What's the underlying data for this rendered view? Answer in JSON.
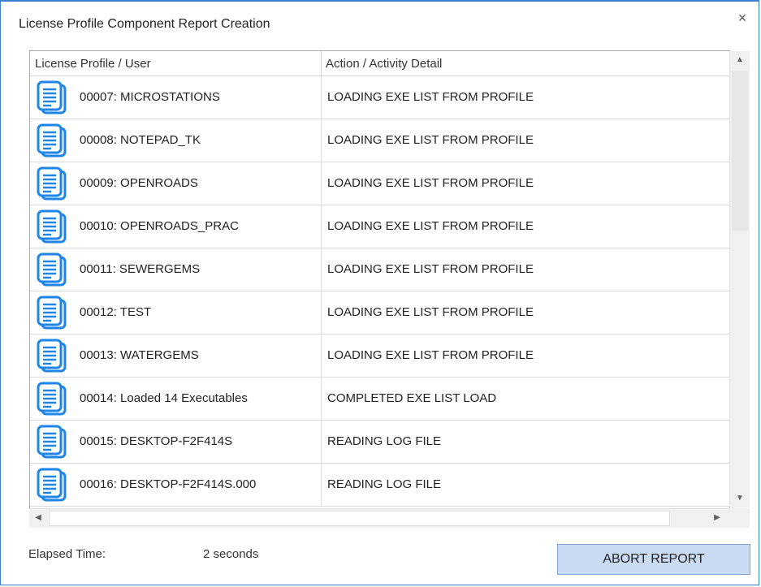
{
  "window": {
    "title": "License Profile Component Report Creation",
    "close_symbol": "×"
  },
  "grid": {
    "columns": [
      "License Profile / User",
      "Action / Activity Detail"
    ],
    "rows": [
      {
        "icon": "document-icon",
        "profile": "00007: MICROSTATIONS",
        "action": "LOADING EXE LIST FROM PROFILE"
      },
      {
        "icon": "document-icon",
        "profile": "00008: NOTEPAD_TK",
        "action": "LOADING EXE LIST FROM PROFILE"
      },
      {
        "icon": "document-icon",
        "profile": "00009: OPENROADS",
        "action": "LOADING EXE LIST FROM PROFILE"
      },
      {
        "icon": "document-icon",
        "profile": "00010: OPENROADS_PRAC",
        "action": "LOADING EXE LIST FROM PROFILE"
      },
      {
        "icon": "document-icon",
        "profile": "00011: SEWERGEMS",
        "action": "LOADING EXE LIST FROM PROFILE"
      },
      {
        "icon": "document-icon",
        "profile": "00012: TEST",
        "action": "LOADING EXE LIST FROM PROFILE"
      },
      {
        "icon": "document-icon",
        "profile": "00013: WATERGEMS",
        "action": "LOADING EXE LIST FROM PROFILE"
      },
      {
        "icon": "document-icon",
        "profile": "00014: Loaded 14 Executables",
        "action": "COMPLETED EXE LIST LOAD"
      },
      {
        "icon": "document-icon",
        "profile": "00015: DESKTOP-F2F414S",
        "action": "READING LOG FILE"
      },
      {
        "icon": "document-icon",
        "profile": "00016: DESKTOP-F2F414S.000",
        "action": "READING LOG FILE"
      }
    ]
  },
  "status": {
    "elapsed_label": "Elapsed Time:",
    "elapsed_value": "2 seconds"
  },
  "buttons": {
    "abort_label": "ABORT REPORT"
  },
  "colors": {
    "window_border": "#3c7fd6",
    "icon_blue": "#1f86e8",
    "button_bg": "#c9dbf2"
  }
}
